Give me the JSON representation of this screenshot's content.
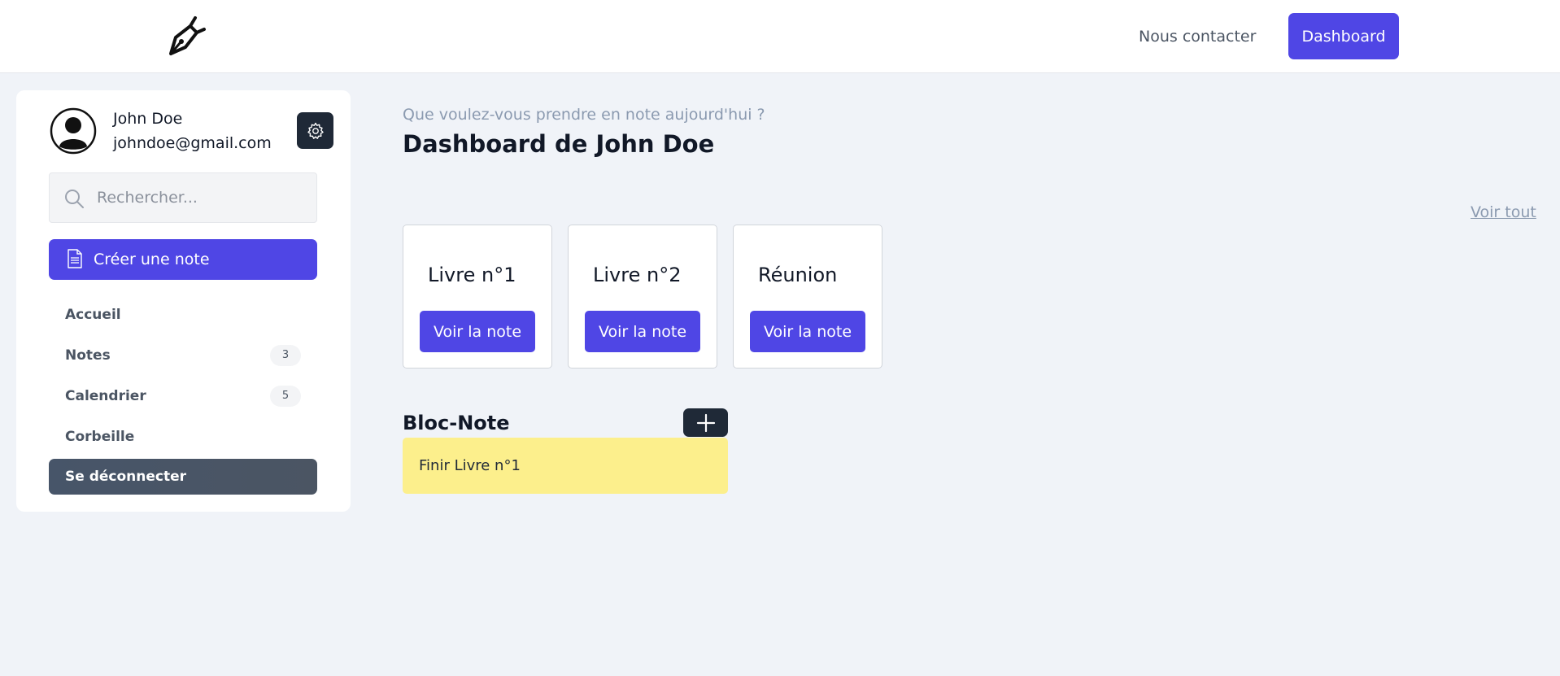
{
  "header": {
    "contact_label": "Nous contacter",
    "dashboard_label": "Dashboard"
  },
  "user": {
    "name": "John Doe",
    "email": "johndoe@gmail.com"
  },
  "search": {
    "placeholder": "Rechercher..."
  },
  "sidebar": {
    "create_label": "Créer une note",
    "items": [
      {
        "label": "Accueil"
      },
      {
        "label": "Notes",
        "badge": "3"
      },
      {
        "label": "Calendrier",
        "badge": "5"
      },
      {
        "label": "Corbeille"
      }
    ],
    "logout_label": "Se déconnecter"
  },
  "main": {
    "subtitle": "Que voulez-vous prendre en note aujourd'hui ?",
    "title": "Dashboard de John Doe",
    "see_all": "Voir tout",
    "cards": [
      {
        "title": "Livre n°1",
        "button": "Voir la note"
      },
      {
        "title": "Livre n°2",
        "button": "Voir la note"
      },
      {
        "title": "Réunion",
        "button": "Voir la note"
      }
    ],
    "bloc": {
      "title": "Bloc-Note",
      "notes": [
        {
          "text": "Finir Livre n°1"
        }
      ]
    }
  },
  "colors": {
    "accent": "#4f46e5",
    "dark": "#1f2937",
    "note_yellow": "#fcef8c",
    "background": "#f0f3f8"
  },
  "icons": [
    "pen-nib-logo-icon",
    "user-avatar-icon",
    "gear-icon",
    "search-icon",
    "document-icon",
    "plus-icon"
  ]
}
